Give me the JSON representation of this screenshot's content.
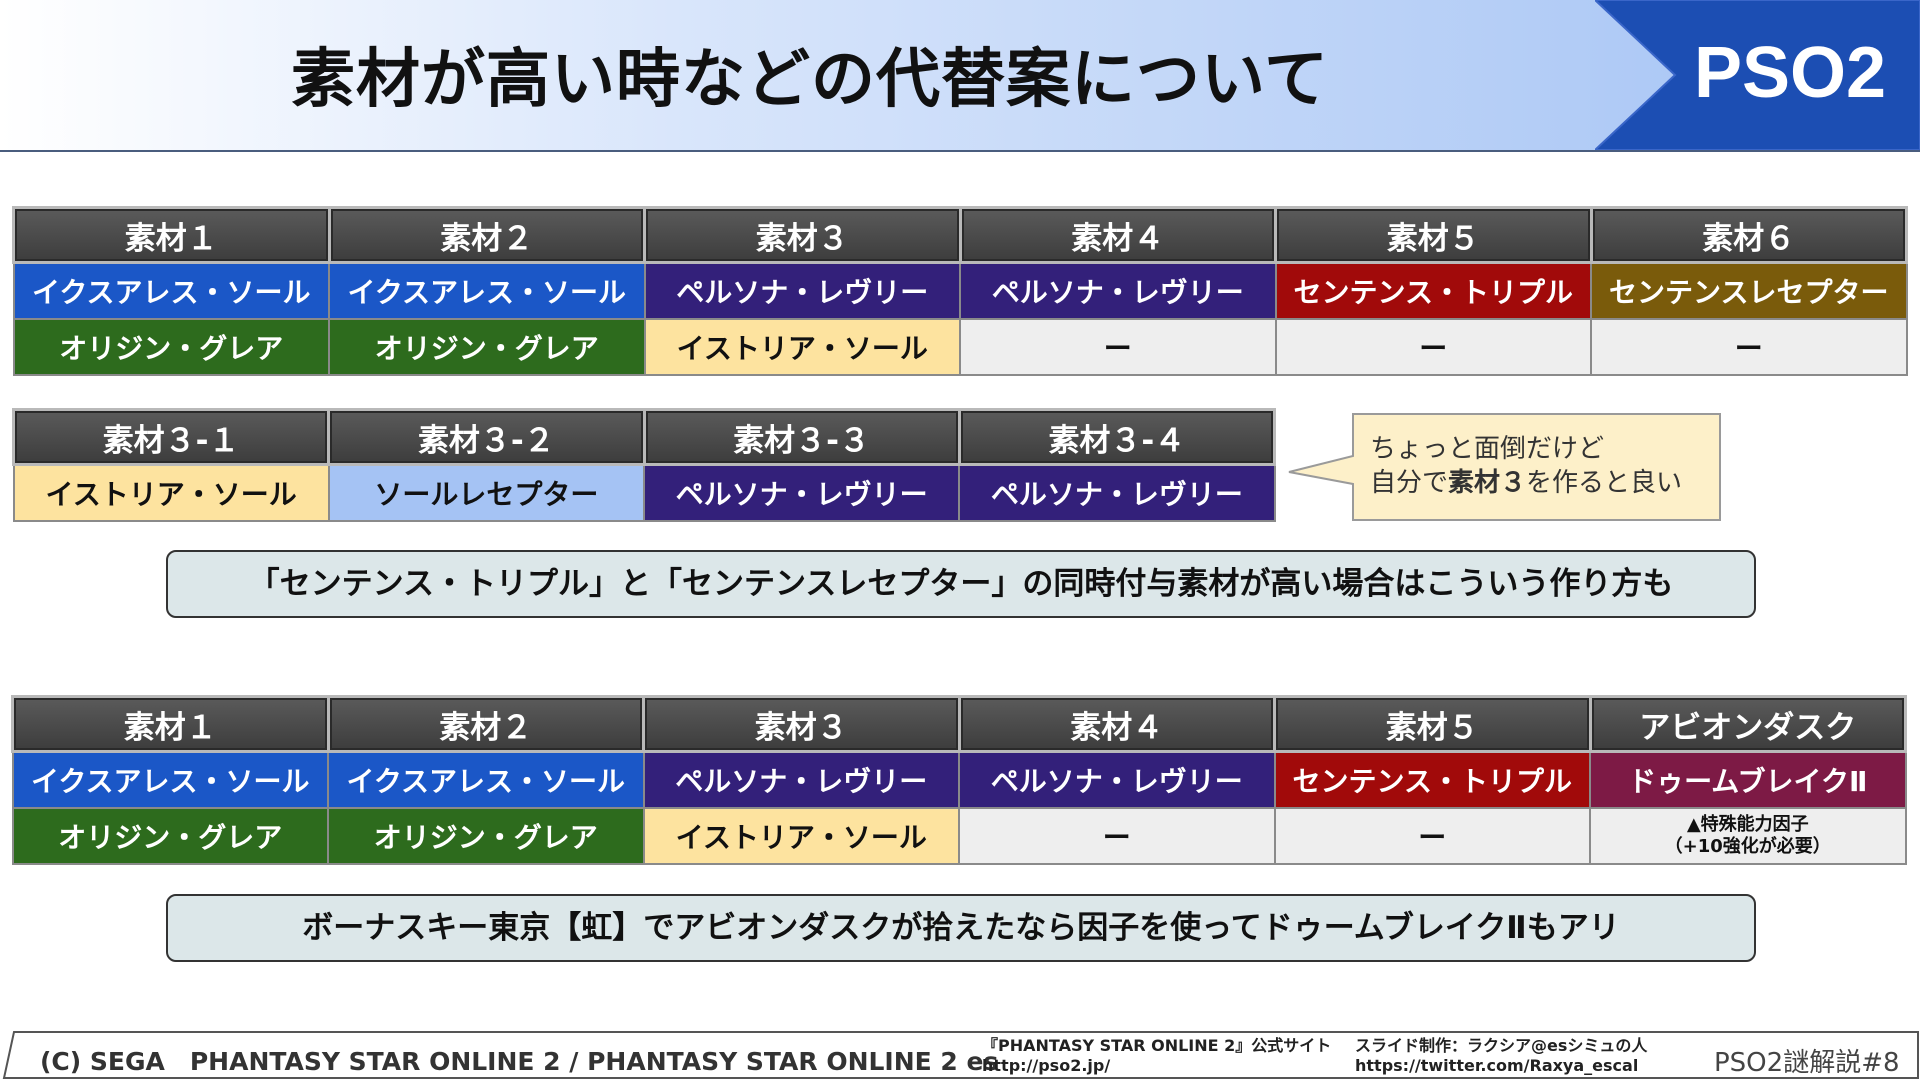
{
  "header": {
    "title": "素材が高い時などの代替案について",
    "brand": "PSO2"
  },
  "table1": {
    "headers": [
      "素材１",
      "素材２",
      "素材３",
      "素材４",
      "素材５",
      "素材６"
    ],
    "row1": [
      "イクスアレス・ソール",
      "イクスアレス・ソール",
      "ペルソナ・レヴリー",
      "ペルソナ・レヴリー",
      "センテンス・トリプル",
      "センテンスレセプター"
    ],
    "row2": [
      "オリジン・グレア",
      "オリジン・グレア",
      "イストリア・ソール",
      "ー",
      "ー",
      "ー"
    ]
  },
  "table2": {
    "headers": [
      "素材３-１",
      "素材３-２",
      "素材３-３",
      "素材３-４"
    ],
    "row1": [
      "イストリア・ソール",
      "ソールレセプター",
      "ペルソナ・レヴリー",
      "ペルソナ・レヴリー"
    ]
  },
  "callout": {
    "line1": "ちょっと面倒だけど",
    "line2_pre": "自分で",
    "line2_bold": "素材３",
    "line2_post": "を作ると良い"
  },
  "note1": "「センテンス・トリプル」と「センテンスレセプター」の同時付与素材が高い場合はこういう作り方も",
  "table3": {
    "headers": [
      "素材１",
      "素材２",
      "素材３",
      "素材４",
      "素材５",
      "アビオンダスク"
    ],
    "row1": [
      "イクスアレス・ソール",
      "イクスアレス・ソール",
      "ペルソナ・レヴリー",
      "ペルソナ・レヴリー",
      "センテンス・トリプル",
      "ドゥームブレイクⅡ"
    ],
    "row2": [
      "オリジン・グレア",
      "オリジン・グレア",
      "イストリア・ソール",
      "ー",
      "ー"
    ],
    "row2_last_line1": "▲特殊能力因子",
    "row2_last_line2": "（+10強化が必要）"
  },
  "note2": "ボーナスキー東京【虹】でアビオンダスクが拾えたなら因子を使ってドゥームブレイクⅡもアリ",
  "footer": {
    "copyright": "(C) SEGA　PHANTASY STAR ONLINE 2 / PHANTASY STAR ONLINE 2 es",
    "site_name": "『PHANTASY STAR ONLINE 2』公式サイト",
    "site_url": "http://pso2.jp/",
    "credit": "スライド制作：ラクシア@esシミュの人",
    "credit_url": "https://twitter.com/Raxya_escal",
    "page": "PSO2謎解説#8"
  },
  "colors": {
    "blue": "#1b57c7",
    "purple": "#33207a",
    "red": "#a10a0a",
    "olive": "#7a5b0b",
    "green": "#2d6b1d",
    "cream": "#fde39f",
    "gray": "#eeeeee",
    "light_blue": "#a5c3f4",
    "wine": "#7d1a45"
  }
}
